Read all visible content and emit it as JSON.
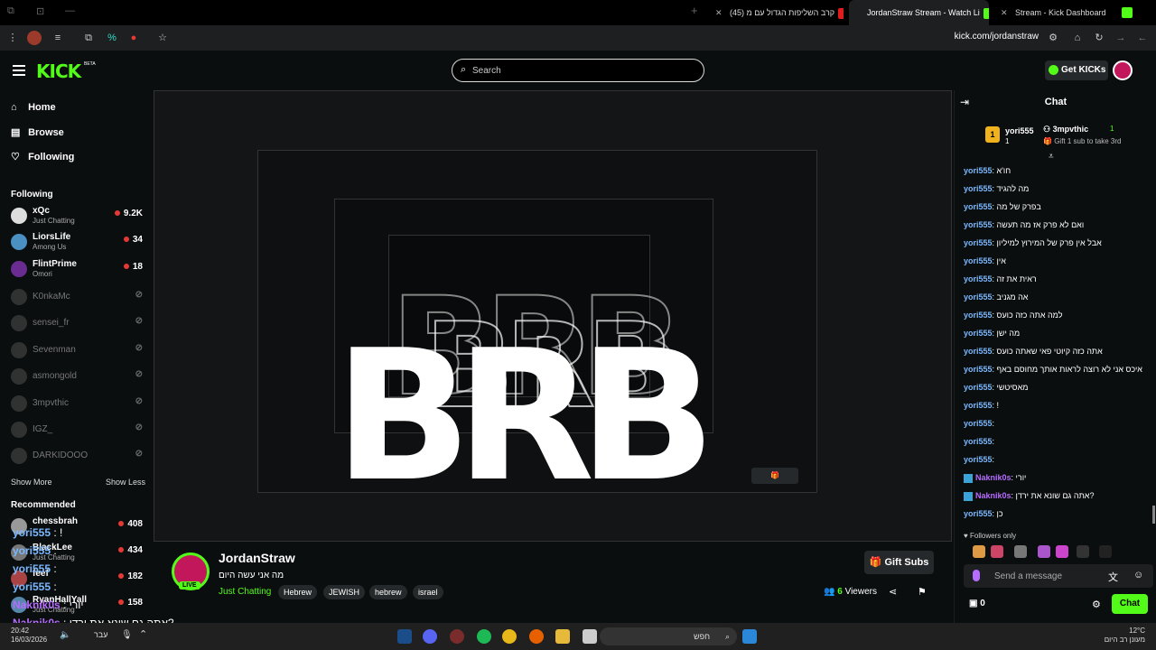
{
  "browser": {
    "tabs": [
      {
        "title": "קרב השליפות הגדול עם מ (45)",
        "favicon": "youtube"
      },
      {
        "title": "JordanStraw Stream - Watch Li",
        "favicon": "kick",
        "active": true
      },
      {
        "title": "Stream - Kick Dashboard",
        "favicon": "kick"
      }
    ],
    "url": "kick.com/jordanstraw"
  },
  "header": {
    "logo": "KICK",
    "beta": "BETA",
    "search_placeholder": "Search",
    "get_kicks": "Get KICKs"
  },
  "sidebar": {
    "nav": [
      {
        "label": "Home",
        "icon": "home-icon"
      },
      {
        "label": "Browse",
        "icon": "browse-icon"
      },
      {
        "label": "Following",
        "icon": "heart-icon"
      }
    ],
    "following_title": "Following",
    "following": [
      {
        "name": "xQc",
        "category": "Just Chatting",
        "viewers": "9.2K",
        "live": true
      },
      {
        "name": "LiorsLife",
        "category": "Among Us",
        "viewers": "34",
        "live": true
      },
      {
        "name": "FlintPrime",
        "category": "Omori",
        "viewers": "18",
        "live": true
      },
      {
        "name": "K0nkaMc",
        "live": false
      },
      {
        "name": "sensei_fr",
        "live": false
      },
      {
        "name": "Sevenman",
        "live": false
      },
      {
        "name": "asmongold",
        "live": false
      },
      {
        "name": "3mpvthic",
        "live": false
      },
      {
        "name": "IGZ_",
        "live": false
      },
      {
        "name": "DARKIDOOO",
        "live": false
      }
    ],
    "show_more": "Show More",
    "show_less": "Show Less",
    "recommended_title": "Recommended",
    "recommended": [
      {
        "name": "chessbrah",
        "category": "",
        "viewers": "408"
      },
      {
        "name": "BlackLee",
        "category": "Just Chatting",
        "viewers": "434"
      },
      {
        "name": "feef",
        "category": "",
        "viewers": "182"
      },
      {
        "name": "RyanHallYall",
        "category": "Just Chatting",
        "viewers": "158"
      }
    ]
  },
  "stream": {
    "overlay_text": "BRB",
    "overlay_chat": [
      {
        "user": "yori555",
        "text": "!"
      },
      {
        "user": "yori555",
        "text": ""
      },
      {
        "user": "yori555",
        "text": ""
      },
      {
        "user": "yori555",
        "text": ""
      },
      {
        "user": "Naknik0s",
        "text": "יורי"
      },
      {
        "user": "Naknik0s",
        "text": "אתה גם שונא את ירדן?"
      },
      {
        "user": "yori555",
        "text": "כן"
      }
    ]
  },
  "info": {
    "channel": "JordanStraw",
    "live": "LIVE",
    "title": "מה אני עשה היום",
    "category": "Just Chatting",
    "tags": [
      "Hebrew",
      "JEWISH",
      "hebrew",
      "israel"
    ],
    "gift_subs": "Gift Subs",
    "viewers": "6",
    "viewers_label": "Viewers"
  },
  "chat": {
    "title": "Chat",
    "gifter1": {
      "rank": "1",
      "name": "yori555",
      "count": "1"
    },
    "gifter2": {
      "name": "3mpvthic",
      "count": "1",
      "sub": "Gift 1 sub to take 3rd"
    },
    "messages": [
      {
        "user": "yori555",
        "text": "חו'א",
        "c": "purple"
      },
      {
        "user": "yori555",
        "text": "מה להגיד",
        "c": "purple"
      },
      {
        "user": "yori555",
        "text": "בפרק של מה",
        "c": "purple"
      },
      {
        "user": "yori555",
        "text": "ואם לא פרק אז מה תעשה",
        "c": "purple"
      },
      {
        "user": "yori555",
        "text": "אבל אין פרק של המירוץ למיליון",
        "c": "purple"
      },
      {
        "user": "yori555",
        "text": "אין",
        "c": "purple"
      },
      {
        "user": "yori555",
        "text": "ראית את זה",
        "c": "purple"
      },
      {
        "user": "yori555",
        "text": "אה מגניב",
        "c": "purple"
      },
      {
        "user": "yori555",
        "text": "למה אתה כזה כועס",
        "c": "purple"
      },
      {
        "user": "yori555",
        "text": "מה ישן",
        "c": "purple"
      },
      {
        "user": "yori555",
        "text": "אתה כזה קיוטי פאי שאתה כועס",
        "c": "purple"
      },
      {
        "user": "yori555",
        "text": "איכס אני לא רוצה לראות אותך מחוסם באף",
        "c": "purple"
      },
      {
        "user": "yori555",
        "text": "מאסיטשי",
        "c": "purple"
      },
      {
        "user": "yori555",
        "text": "!",
        "c": "purple"
      },
      {
        "user": "yori555",
        "text": "",
        "c": "purple"
      },
      {
        "user": "yori555",
        "text": "",
        "c": "purple"
      },
      {
        "user": "yori555",
        "text": "",
        "c": "purple"
      },
      {
        "user": "Naknik0s",
        "text": "יורי",
        "c": "pink"
      },
      {
        "user": "Naknik0s",
        "text": "אתה גם שונא את ירדן?",
        "c": "pink"
      },
      {
        "user": "yori555",
        "text": "כן",
        "c": "purple"
      }
    ],
    "followers_only": "Followers only",
    "send_placeholder": "Send a message",
    "chat_button": "Chat",
    "kicks_count": "0"
  },
  "taskbar": {
    "time": "20:42",
    "date": "16/03/2026",
    "lang": "עבר",
    "search": "חפש",
    "temp": "12°C",
    "weather": "מעונן רב היום"
  },
  "colors": {
    "accent": "#53fc18",
    "bg": "#0b0e0f",
    "panel": "#26292b"
  }
}
